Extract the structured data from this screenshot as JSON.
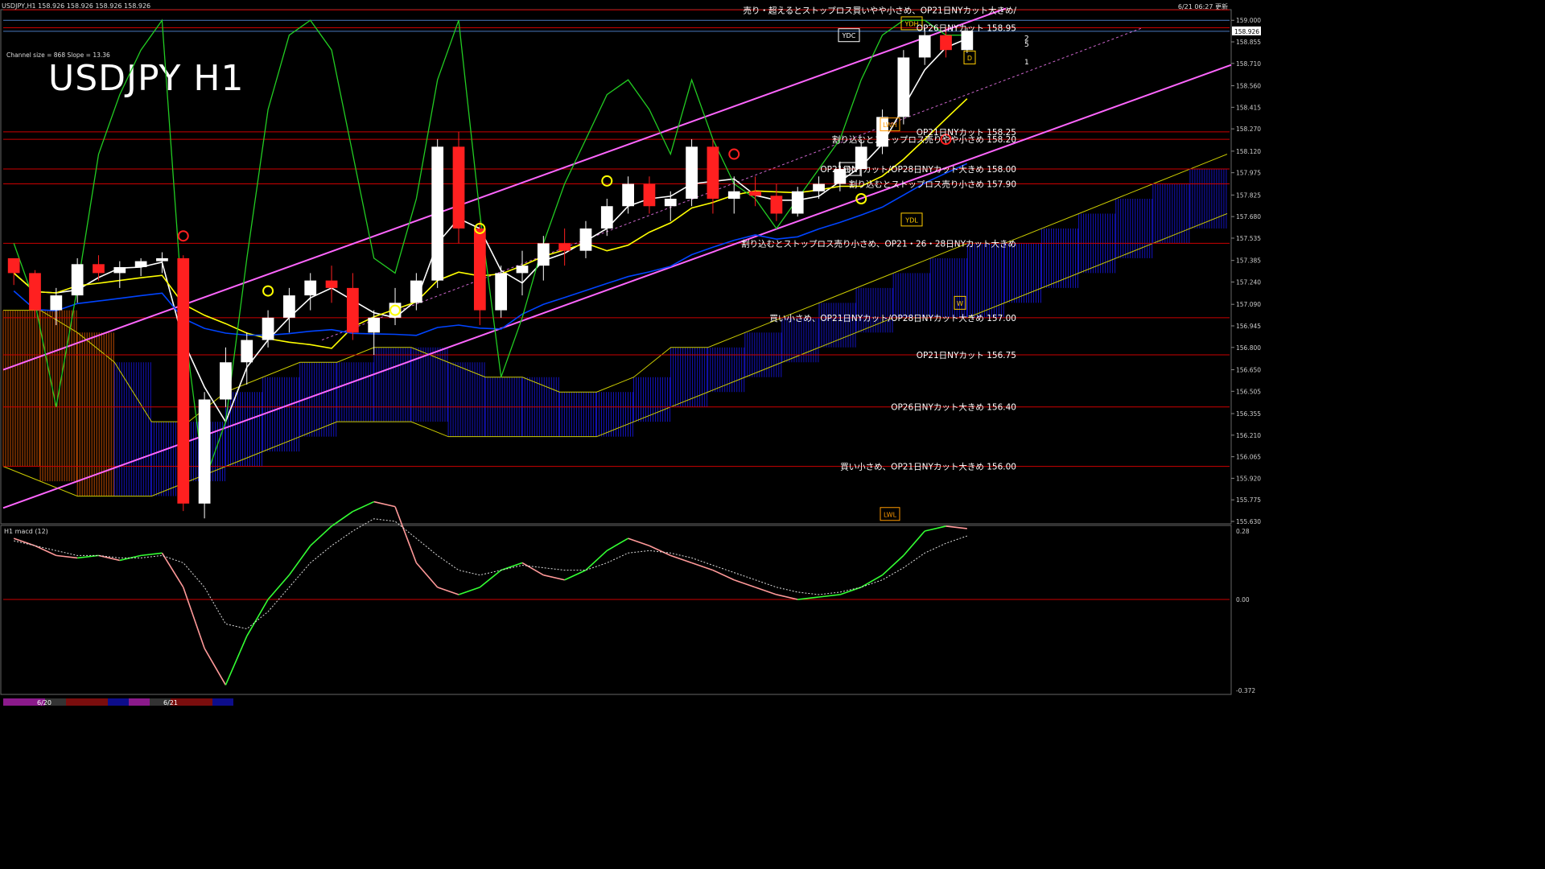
{
  "header": {
    "symbol_line": "USDJPY,H1  158.926 158.926 158.926 158.926",
    "updated": "6/21 06:27 更新",
    "channel_info": "Channel size = 868 Slope = 13.36",
    "title": "USDJPY H1"
  },
  "annotations": [
    {
      "text": "売り・超えるとストップロス買いやや小さめ、OP21日NYカット大きめ/",
      "price": 159.07
    },
    {
      "text": "OP26日NYカット 158.95",
      "price": 158.95
    },
    {
      "text": "OP21日NYカット 158.25",
      "price": 158.25
    },
    {
      "text": "割り込むとストップロス売りやや小さめ 158.20",
      "price": 158.2
    },
    {
      "text": "OP21日NYカット/OP28日NYカット大きめ 158.00",
      "price": 158.0
    },
    {
      "text": "割り込むとストップロス売り小さめ 157.90",
      "price": 157.9
    },
    {
      "text": "割り込むとストップロス売り小さめ、OP21・26・28日NYカット大きめ",
      "price": 157.5
    },
    {
      "text": "買い小さめ、OP21日NYカット/OP28日NYカット大きめ 157.00",
      "price": 157.0
    },
    {
      "text": "OP21日NYカット 156.75",
      "price": 156.75
    },
    {
      "text": "OP26日NYカット大きめ 156.40",
      "price": 156.4
    },
    {
      "text": "買い小さめ、OP21日NYカット大きめ 156.00",
      "price": 156.0
    }
  ],
  "markers": {
    "ydh": "YDH",
    "ydc": "YDC",
    "ydo": "YDO",
    "ydl": "YDL",
    "lwh": "LWH",
    "lwl": "LWL",
    "d": "D",
    "w": "W",
    "n1": "1",
    "n2": "2",
    "n5": "5"
  },
  "chart_data": {
    "type": "candlestick",
    "price_axis": {
      "range": [
        155.63,
        159.05
      ],
      "ticks": [
        "159.000",
        "158.855",
        "158.710",
        "158.560",
        "158.415",
        "158.270",
        "158.120",
        "157.975",
        "157.825",
        "157.680",
        "157.535",
        "157.385",
        "157.240",
        "157.090",
        "156.945",
        "156.800",
        "156.650",
        "156.505",
        "156.355",
        "156.210",
        "156.065",
        "155.920",
        "155.775",
        "155.630"
      ],
      "current": "158.926"
    },
    "date_labels": [
      "6/20",
      "6/21"
    ],
    "candles": [
      [
        157.4,
        157.35,
        157.22,
        157.3
      ],
      [
        157.3,
        157.32,
        157.0,
        157.05
      ],
      [
        157.05,
        157.2,
        156.95,
        157.15
      ],
      [
        157.15,
        157.4,
        157.1,
        157.36
      ],
      [
        157.36,
        157.42,
        157.25,
        157.3
      ],
      [
        157.3,
        157.38,
        157.2,
        157.34
      ],
      [
        157.34,
        157.4,
        157.28,
        157.38
      ],
      [
        157.38,
        157.44,
        157.3,
        157.4
      ],
      [
        157.4,
        157.42,
        155.7,
        155.75
      ],
      [
        155.75,
        156.5,
        155.65,
        156.45
      ],
      [
        156.45,
        156.8,
        156.4,
        156.7
      ],
      [
        156.7,
        156.9,
        156.55,
        156.85
      ],
      [
        156.85,
        157.05,
        156.8,
        157.0
      ],
      [
        157.0,
        157.2,
        156.9,
        157.15
      ],
      [
        157.15,
        157.3,
        157.05,
        157.25
      ],
      [
        157.25,
        157.35,
        157.1,
        157.2
      ],
      [
        157.2,
        157.3,
        156.85,
        156.9
      ],
      [
        156.9,
        157.05,
        156.75,
        157.0
      ],
      [
        157.0,
        157.2,
        156.95,
        157.1
      ],
      [
        157.1,
        157.3,
        157.05,
        157.25
      ],
      [
        157.25,
        158.2,
        157.2,
        158.15
      ],
      [
        158.15,
        158.25,
        157.5,
        157.6
      ],
      [
        157.6,
        157.65,
        156.95,
        157.05
      ],
      [
        157.05,
        157.35,
        157.0,
        157.3
      ],
      [
        157.3,
        157.45,
        157.15,
        157.35
      ],
      [
        157.35,
        157.55,
        157.25,
        157.5
      ],
      [
        157.5,
        157.6,
        157.35,
        157.45
      ],
      [
        157.45,
        157.65,
        157.4,
        157.6
      ],
      [
        157.6,
        157.8,
        157.55,
        157.75
      ],
      [
        157.75,
        157.95,
        157.7,
        157.9
      ],
      [
        157.9,
        157.95,
        157.7,
        157.75
      ],
      [
        157.75,
        157.85,
        157.65,
        157.8
      ],
      [
        157.8,
        158.2,
        157.75,
        158.15
      ],
      [
        158.15,
        158.2,
        157.7,
        157.8
      ],
      [
        157.8,
        157.95,
        157.7,
        157.85
      ],
      [
        157.85,
        157.95,
        157.75,
        157.82
      ],
      [
        157.82,
        157.9,
        157.65,
        157.7
      ],
      [
        157.7,
        157.88,
        157.68,
        157.85
      ],
      [
        157.85,
        157.95,
        157.8,
        157.9
      ],
      [
        157.9,
        158.05,
        157.85,
        158.0
      ],
      [
        158.0,
        158.2,
        157.95,
        158.15
      ],
      [
        158.15,
        158.4,
        158.1,
        158.35
      ],
      [
        158.35,
        158.8,
        158.3,
        158.75
      ],
      [
        158.75,
        158.95,
        158.7,
        158.9
      ],
      [
        158.9,
        158.95,
        158.75,
        158.8
      ],
      [
        158.8,
        158.95,
        158.78,
        158.93
      ]
    ],
    "indicator": {
      "name": "H1  macd (12)",
      "range": [
        -0.372,
        0.28
      ],
      "ticks": [
        "0.28",
        "0.00",
        "-0.372"
      ],
      "macd": [
        0.25,
        0.22,
        0.18,
        0.17,
        0.18,
        0.16,
        0.18,
        0.19,
        0.05,
        -0.2,
        -0.35,
        -0.15,
        0.0,
        0.1,
        0.22,
        0.3,
        0.36,
        0.4,
        0.38,
        0.15,
        0.05,
        0.02,
        0.05,
        0.12,
        0.15,
        0.1,
        0.08,
        0.12,
        0.2,
        0.25,
        0.22,
        0.18,
        0.15,
        0.12,
        0.08,
        0.05,
        0.02,
        0.0,
        0.01,
        0.02,
        0.05,
        0.1,
        0.18,
        0.28,
        0.3,
        0.29
      ],
      "signal": [
        0.24,
        0.22,
        0.2,
        0.18,
        0.18,
        0.17,
        0.17,
        0.18,
        0.15,
        0.05,
        -0.1,
        -0.12,
        -0.05,
        0.05,
        0.15,
        0.22,
        0.28,
        0.33,
        0.32,
        0.25,
        0.18,
        0.12,
        0.1,
        0.12,
        0.14,
        0.13,
        0.12,
        0.12,
        0.15,
        0.19,
        0.2,
        0.19,
        0.17,
        0.14,
        0.11,
        0.08,
        0.05,
        0.03,
        0.02,
        0.03,
        0.05,
        0.08,
        0.13,
        0.19,
        0.23,
        0.26
      ]
    },
    "x_label": "",
    "y_label": ""
  },
  "colors": {
    "bull": "#ffffff",
    "bear": "#ff2020",
    "channel": "#ff66ff",
    "level": "#cc0000",
    "cloud_a": "#1a1aff",
    "cloud_b": "#ff6600",
    "ma_fast": "#ffffff",
    "ma_mid": "#ffff00",
    "ma_slow": "#0044ff",
    "stoch": "#22cc22",
    "macd_up": "#33ff33",
    "macd_dn": "#ff9999"
  }
}
